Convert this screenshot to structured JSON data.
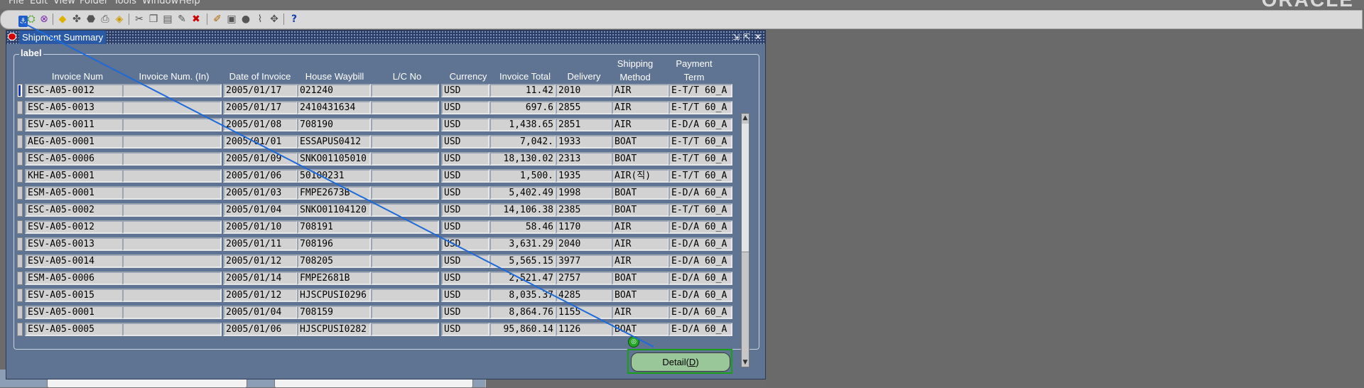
{
  "menu": [
    "File",
    "Edit",
    "View",
    "Folder",
    "Tools",
    "Window",
    "Help"
  ],
  "brand": "ORACLE",
  "toolbar_icons": [
    "open-icon",
    "navigator-icon",
    "zoom-icon",
    "save-icon",
    "next-step-icon",
    "switch-responsibility-icon",
    "print-icon",
    "close-form-icon",
    "cut-icon",
    "copy-icon",
    "paste-icon",
    "new-record-icon",
    "delete-record-icon",
    "edit-field-icon",
    "zoom-in-icon",
    "translations-icon",
    "attachments-icon",
    "folder-tools-icon",
    "help-icon"
  ],
  "window": {
    "title": "Shipment Summary",
    "group_label": "label",
    "columns": [
      "Invoice Num",
      "Invoice Num. (In)",
      "Date of Invoice",
      "House Waybill",
      "L/C No",
      "Currency",
      "Invoice Total",
      "Delivery",
      "Shipping Method",
      "Payment Term"
    ],
    "rows": [
      [
        "ESC-A05-0012",
        "",
        "2005/01/17",
        "021240",
        "",
        "USD",
        "11.42",
        "2010",
        "AIR",
        "E-T/T 60_A"
      ],
      [
        "ESC-A05-0013",
        "",
        "2005/01/17",
        "2410431634",
        "",
        "USD",
        "697.6",
        "2855",
        "AIR",
        "E-T/T 60_A"
      ],
      [
        "ESV-A05-0011",
        "",
        "2005/01/08",
        "708190",
        "",
        "USD",
        "1,438.65",
        "2851",
        "AIR",
        "E-D/A 60_A"
      ],
      [
        "AEG-A05-0001",
        "",
        "2005/01/01",
        "ESSAPUS0412",
        "",
        "USD",
        "7,042.",
        "1933",
        "BOAT",
        "E-T/T 60_A"
      ],
      [
        "ESC-A05-0006",
        "",
        "2005/01/09",
        "SNKO01105010",
        "",
        "USD",
        "18,130.02",
        "2313",
        "BOAT",
        "E-T/T 60_A"
      ],
      [
        "KHE-A05-0001",
        "",
        "2005/01/06",
        "50100231",
        "",
        "USD",
        "1,500.",
        "1935",
        "AIR(직)",
        "E-T/T 60_A"
      ],
      [
        "ESM-A05-0001",
        "",
        "2005/01/03",
        "FMPE2673B",
        "",
        "USD",
        "5,402.49",
        "1998",
        "BOAT",
        "E-D/A 60_A"
      ],
      [
        "ESC-A05-0002",
        "",
        "2005/01/04",
        "SNKO01104120",
        "",
        "USD",
        "14,106.38",
        "2385",
        "BOAT",
        "E-T/T 60_A"
      ],
      [
        "ESV-A05-0012",
        "",
        "2005/01/10",
        "708191",
        "",
        "USD",
        "58.46",
        "1170",
        "AIR",
        "E-D/A 60_A"
      ],
      [
        "ESV-A05-0013",
        "",
        "2005/01/11",
        "708196",
        "",
        "USD",
        "3,631.29",
        "2040",
        "AIR",
        "E-D/A 60_A"
      ],
      [
        "ESV-A05-0014",
        "",
        "2005/01/12",
        "708205",
        "",
        "USD",
        "5,565.15",
        "3977",
        "AIR",
        "E-D/A 60_A"
      ],
      [
        "ESM-A05-0006",
        "",
        "2005/01/14",
        "FMPE2681B",
        "",
        "USD",
        "2,521.47",
        "2757",
        "BOAT",
        "E-D/A 60_A"
      ],
      [
        "ESV-A05-0015",
        "",
        "2005/01/12",
        "HJSCPUSI0296",
        "",
        "USD",
        "8,035.37",
        "4285",
        "BOAT",
        "E-D/A 60_A"
      ],
      [
        "ESV-A05-0001",
        "",
        "2005/01/04",
        "708159",
        "",
        "USD",
        "8,864.76",
        "1155",
        "AIR",
        "E-D/A 60_A"
      ],
      [
        "ESV-A05-0005",
        "",
        "2005/01/06",
        "HJSCPUSI0282",
        "",
        "USD",
        "95,860.14",
        "1126",
        "BOAT",
        "E-D/A 60_A"
      ]
    ],
    "detail_button": {
      "label": "Detail(",
      "mnemonic": "D",
      "suffix": ")"
    }
  },
  "colors": {
    "window_bg": "#5f7392",
    "title_bg": "#2a3d66",
    "field_bg": "#d2d2d2",
    "highlight": "#18a018",
    "pointer_line": "#1f6ad6"
  }
}
